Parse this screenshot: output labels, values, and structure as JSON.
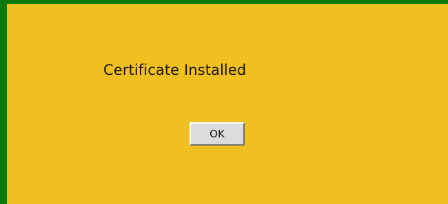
{
  "dialog": {
    "message": "Certificate Installed",
    "ok_label": "OK"
  },
  "colors": {
    "border": "#0e7a0e",
    "background": "#efc020",
    "button": "#dcdcdc"
  }
}
